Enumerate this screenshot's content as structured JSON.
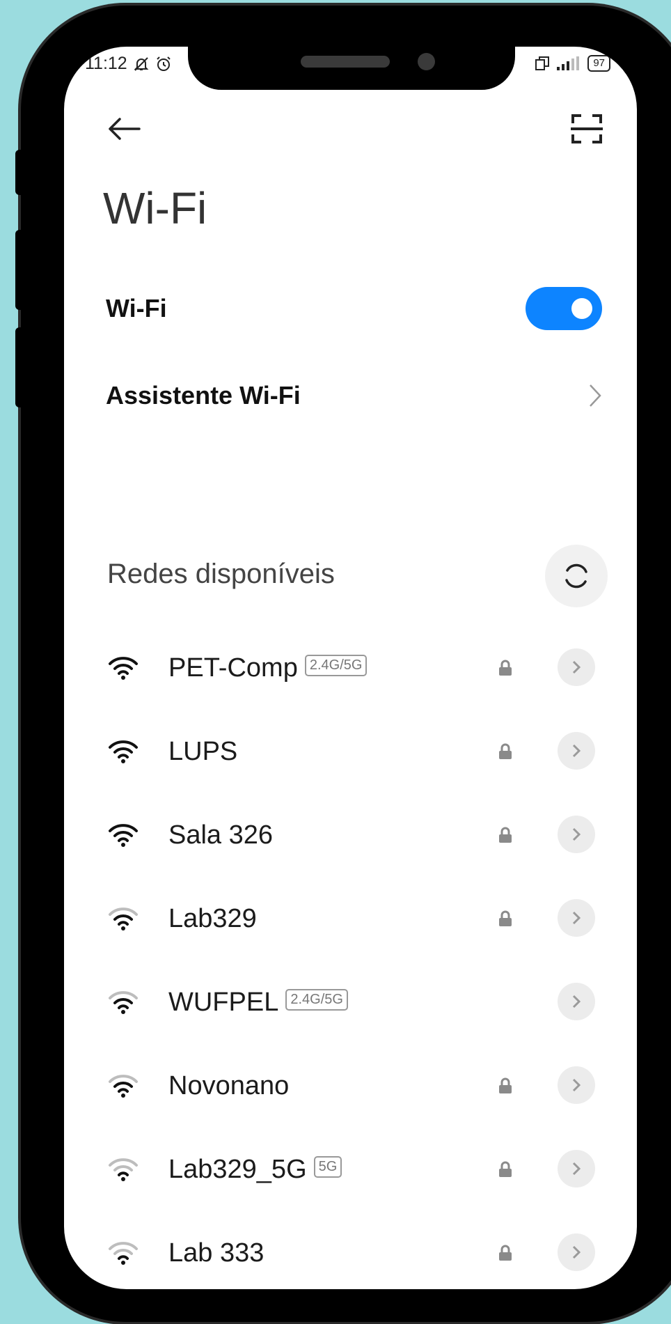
{
  "status_bar": {
    "time": "11:12",
    "battery": "97"
  },
  "page": {
    "title": "Wi-Fi"
  },
  "settings": {
    "wifi_label": "Wi-Fi",
    "wifi_enabled": true,
    "assistant_label": "Assistente Wi-Fi"
  },
  "networks_section": {
    "title": "Redes disponíveis"
  },
  "networks": [
    {
      "name": "PET-Comp",
      "band": "2.4G/5G",
      "locked": true,
      "signal": "full"
    },
    {
      "name": "LUPS",
      "band": "",
      "locked": true,
      "signal": "full"
    },
    {
      "name": "Sala 326",
      "band": "",
      "locked": true,
      "signal": "full"
    },
    {
      "name": "Lab329",
      "band": "",
      "locked": true,
      "signal": "medium"
    },
    {
      "name": "WUFPEL",
      "band": "2.4G/5G",
      "locked": false,
      "signal": "medium"
    },
    {
      "name": "Novonano",
      "band": "",
      "locked": true,
      "signal": "medium"
    },
    {
      "name": "Lab329_5G",
      "band": "5G",
      "locked": true,
      "signal": "weak"
    },
    {
      "name": "Lab 333",
      "band": "",
      "locked": true,
      "signal": "weak"
    }
  ],
  "colors": {
    "accent": "#0d84ff",
    "background": "#9bdcdf"
  }
}
